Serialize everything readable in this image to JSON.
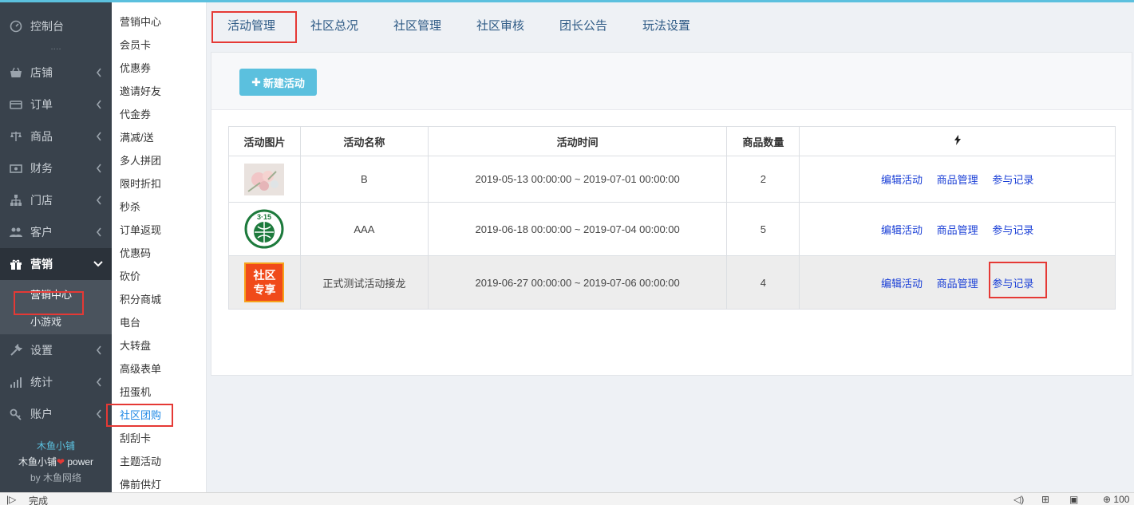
{
  "sidebar": {
    "items": [
      {
        "label": "控制台",
        "icon": "dashboard-icon"
      },
      {
        "label": "店铺",
        "icon": "store-icon"
      },
      {
        "label": "订单",
        "icon": "order-icon"
      },
      {
        "label": "商品",
        "icon": "scale-icon"
      },
      {
        "label": "财务",
        "icon": "money-icon"
      },
      {
        "label": "门店",
        "icon": "sitemap-icon"
      },
      {
        "label": "客户",
        "icon": "users-icon"
      },
      {
        "label": "营销",
        "icon": "gift-icon"
      },
      {
        "label": "设置",
        "icon": "wrench-icon"
      },
      {
        "label": "统计",
        "icon": "bar-signal-icon"
      },
      {
        "label": "账户",
        "icon": "key-icon"
      }
    ],
    "marketing_sub": [
      "营销中心",
      "小游戏"
    ],
    "footer": {
      "brand": "木鱼小铺",
      "power_prefix": "木鱼小铺",
      "power_suffix": "power",
      "by": "by 木鱼网络"
    }
  },
  "submenu": {
    "items": [
      "营销中心",
      "会员卡",
      "优惠券",
      "邀请好友",
      "代金券",
      "满减/送",
      "多人拼团",
      "限时折扣",
      "秒杀",
      "订单返现",
      "优惠码",
      "砍价",
      "积分商城",
      "电台",
      "大转盘",
      "高级表单",
      "扭蛋机",
      "社区团购",
      "刮刮卡",
      "主题活动",
      "佛前供灯"
    ]
  },
  "tabs": [
    "活动管理",
    "社区总况",
    "社区管理",
    "社区审核",
    "团长公告",
    "玩法设置"
  ],
  "toolbar": {
    "new_label": "新建活动"
  },
  "table": {
    "headers": {
      "image": "活动图片",
      "name": "活动名称",
      "time": "活动时间",
      "count": "商品数量",
      "ops_icon": "lightning-icon"
    },
    "rows": [
      {
        "name": "B",
        "time": "2019-05-13 00:00:00 ~ 2019-07-01 00:00:00",
        "count": "2",
        "thumb": "flowers-thumbnail"
      },
      {
        "name": "AAA",
        "time": "2019-06-18 00:00:00 ~ 2019-07-04 00:00:00",
        "count": "5",
        "thumb": "315-logo-thumbnail"
      },
      {
        "name": "正式测试活动接龙",
        "time": "2019-06-27 00:00:00 ~ 2019-07-06 00:00:00",
        "count": "4",
        "thumb": "community-share-thumbnail",
        "thumb_text_1": "社区",
        "thumb_text_2": "专享"
      }
    ],
    "ops": {
      "edit": "编辑活动",
      "goods": "商品管理",
      "records": "参与记录"
    }
  },
  "statusbar": {
    "status": "完成",
    "zoom": "100"
  },
  "colors": {
    "accent": "#5bc0de",
    "highlight": "#e53935",
    "link": "#1a3fd6",
    "tab_text": "#2f5b86",
    "sidebar_bg": "#39424c"
  }
}
